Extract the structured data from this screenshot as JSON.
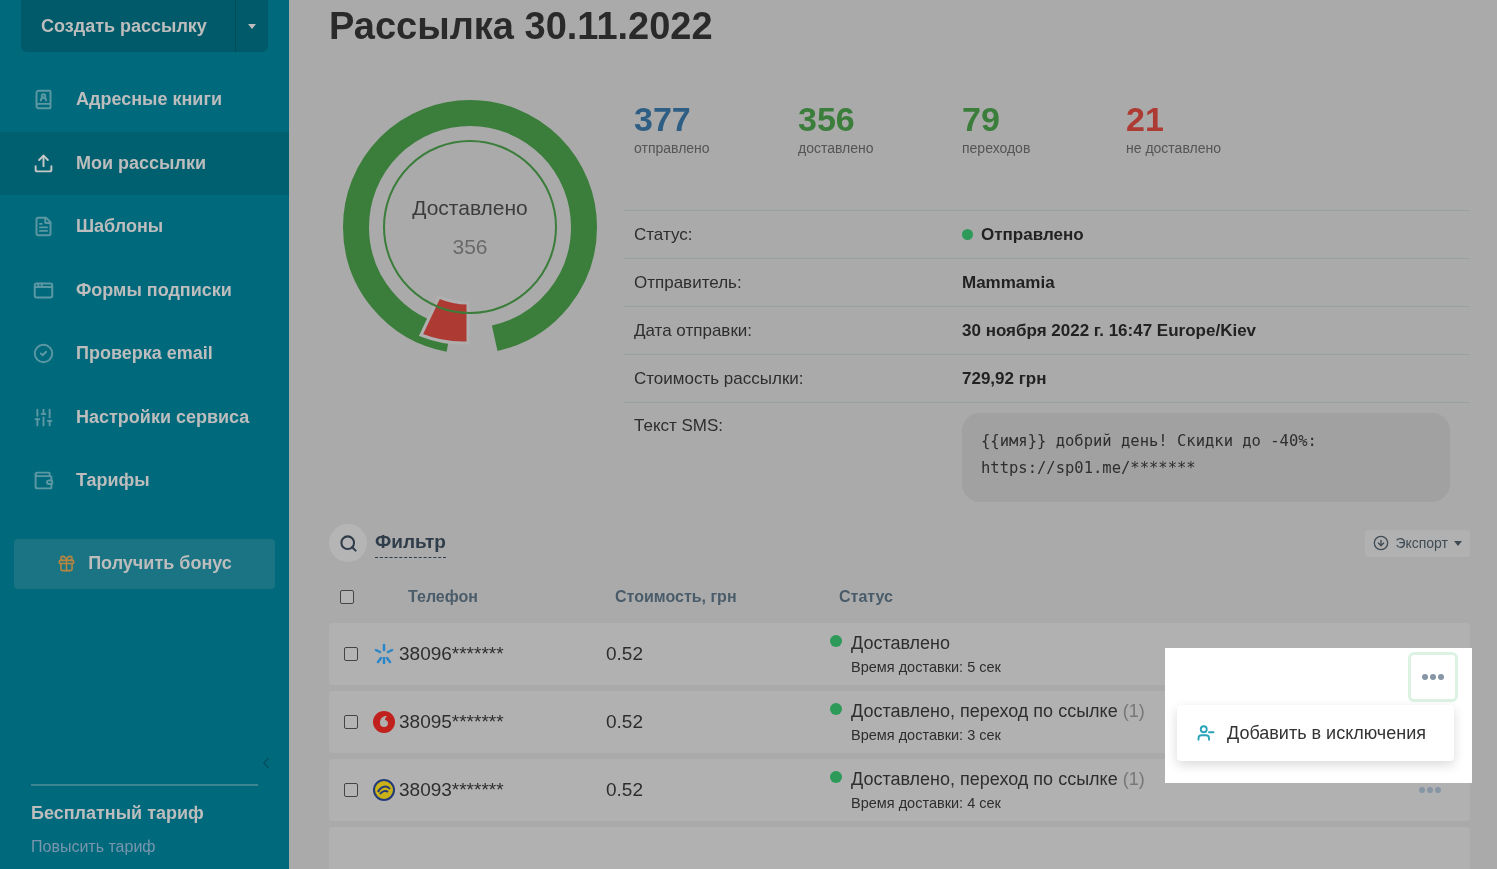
{
  "sidebar": {
    "create_button": "Создать рассылку",
    "items": [
      {
        "kind": "book",
        "label": "Адресные книги",
        "selected": false
      },
      {
        "kind": "upload",
        "label": "Мои рассылки",
        "selected": true
      },
      {
        "kind": "template",
        "label": "Шаблоны",
        "selected": false
      },
      {
        "kind": "form",
        "label": "Формы подписки",
        "selected": false
      },
      {
        "kind": "check",
        "label": "Проверка email",
        "selected": false
      },
      {
        "kind": "sliders",
        "label": "Настройки сервиса",
        "selected": false
      },
      {
        "kind": "wallet",
        "label": "Тарифы",
        "selected": false
      }
    ],
    "bonus_button": "Получить бонус",
    "plan": "Бесплатный тариф",
    "upgrade_link": "Повысить тариф"
  },
  "title": "Рассылка 30.11.2022",
  "donut": {
    "label": "Доставлено",
    "value": "356"
  },
  "stats": [
    {
      "value": "377",
      "label": "отправлено",
      "color": "#2f5e85"
    },
    {
      "value": "356",
      "label": "доставлено",
      "color": "#3b7d3b"
    },
    {
      "value": "79",
      "label": "переходов",
      "color": "#3b7d3b"
    },
    {
      "value": "21",
      "label": "не доставлено",
      "color": "#ae3b33"
    }
  ],
  "details": [
    {
      "label": "Статус:",
      "value": "Отправлено",
      "kind": "status"
    },
    {
      "label": "Отправитель:",
      "value": "Mammamia",
      "kind": "text"
    },
    {
      "label": "Дата отправки:",
      "value": "30 ноября 2022 г. 16:47 Europe/Kiev",
      "kind": "text"
    },
    {
      "label": "Стоимость рассылки:",
      "value": "729,92 грн",
      "kind": "text"
    },
    {
      "label": "Текст SMS:",
      "value": "{{имя}} добрий день! Скидки до -40%: https://sp01.me/*******",
      "kind": "sms"
    }
  ],
  "filter": "Фильтр",
  "export_button": "Экспорт",
  "table": {
    "all_checked": false,
    "columns": [
      "Телефон",
      "Стоимость, грн",
      "Статус"
    ],
    "rows": [
      {
        "checked": false,
        "kind": "asterisk",
        "phone": "38096*******",
        "cost": "0.52",
        "status": "Доставлено",
        "time": "Время доставки: 5 сек",
        "color": "#2e9a5a"
      },
      {
        "checked": false,
        "kind": "drop",
        "phone": "38095*******",
        "cost": "0.52",
        "status": "Доставлено, переход по ссылке",
        "count": "(1)",
        "time": "Время доставки: 3 сек",
        "color": "#2e9a5a"
      },
      {
        "checked": false,
        "kind": "swirl",
        "phone": "38093*******",
        "cost": "0.52",
        "status": "Доставлено, переход по ссылке",
        "count": "(1)",
        "time": "Время доставки: 4 сек",
        "color": "#2e9a5a"
      }
    ]
  },
  "menu": {
    "items": [
      "Добавить в исключения"
    ]
  }
}
